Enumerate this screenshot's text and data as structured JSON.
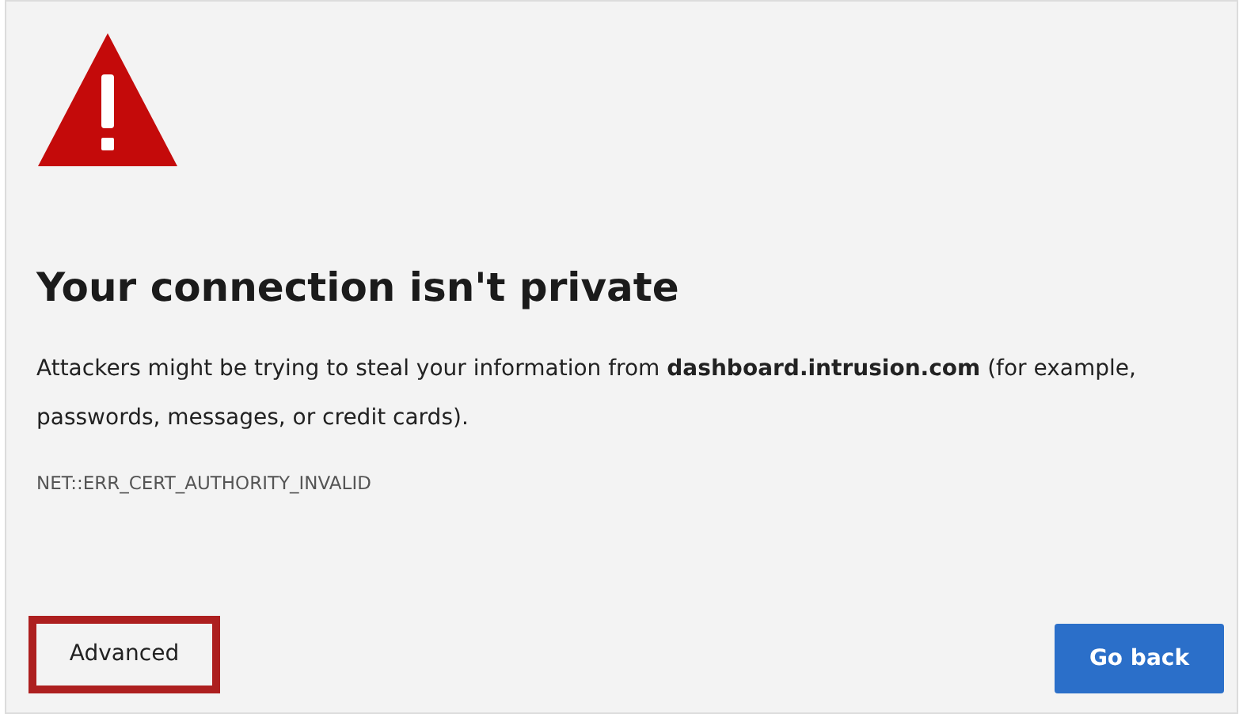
{
  "title": "Your connection isn't private",
  "message": "Attackers might be trying to steal your information from **dashboard.intrusion.com** (for example, passwords, messages, or credit cards).",
  "error_code": "NET::ERR_CERT_AUTHORITY_INVALID",
  "buttons": [
    {
      "label": "Advanced",
      "kind": "secondary",
      "highlighted": true
    },
    {
      "label": "Go back",
      "kind": "primary",
      "highlighted": false
    }
  ]
}
